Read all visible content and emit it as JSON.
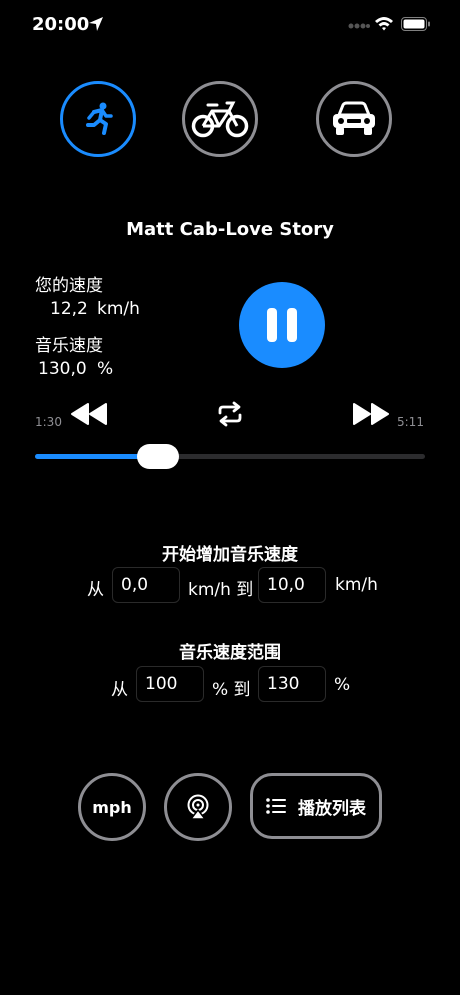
{
  "status_bar": {
    "time": "20:00"
  },
  "modes": [
    {
      "name": "running",
      "icon": "running-icon",
      "active": true
    },
    {
      "name": "bicycle",
      "icon": "bicycle-icon",
      "active": false
    },
    {
      "name": "car",
      "icon": "car-icon",
      "active": false
    }
  ],
  "player": {
    "song_title": "Matt Cab-Love Story",
    "your_speed_label": "您的速度",
    "your_speed_value": "12,2",
    "speed_unit": "km/h",
    "music_speed_label": "音乐速度",
    "music_speed_value": "130,0",
    "percent_unit": "%",
    "elapsed": "1:30",
    "duration": "5:11",
    "progress_fraction": 0.29,
    "state": "playing"
  },
  "increase_section": {
    "title": "开始增加音乐速度",
    "from_label": "从",
    "from_value": "0,0",
    "unit_to": "km/h 到",
    "to_value": "10,0",
    "unit": "km/h"
  },
  "range_section": {
    "title": "音乐速度范围",
    "from_label": "从",
    "from_value": "100",
    "unit_to": "% 到",
    "to_value": "130",
    "unit": "%"
  },
  "bottom": {
    "unit_button": "mph",
    "airplay_icon": "airplay-icon",
    "playlist_label": "播放列表",
    "playlist_icon": "list-icon"
  },
  "colors": {
    "accent": "#1a8cff",
    "background": "#000000",
    "ring": "#8e8e93"
  }
}
